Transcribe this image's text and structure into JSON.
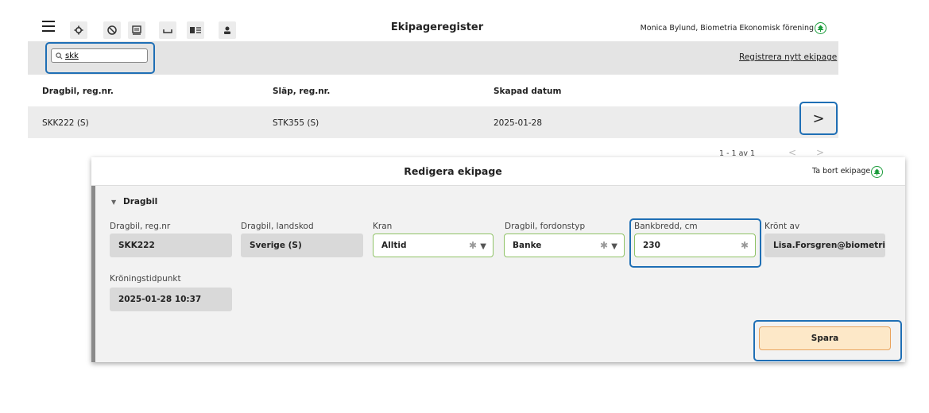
{
  "app": {
    "title": "Ekipageregister",
    "user": "Monica Bylund, Biometria Ekonomisk förening"
  },
  "toolbar": {
    "icons": [
      "menu-icon",
      "gear-icon",
      "no-entry-icon",
      "truck-icon",
      "trailer-icon",
      "vehicle-list-icon",
      "user-icon"
    ]
  },
  "search": {
    "value": "skk"
  },
  "register_link": "Registrera nytt ekipage",
  "table": {
    "headers": [
      "Dragbil, reg.nr.",
      "Släp, reg.nr.",
      "Skapad datum"
    ],
    "rows": [
      [
        "SKK222 (S)",
        "STK355 (S)",
        "2025-01-28"
      ]
    ],
    "row_action": ">"
  },
  "pager": {
    "text": "1 - 1 av 1",
    "prev": "<",
    "next": ">"
  },
  "modal": {
    "title": "Redigera ekipage",
    "delete_label": "Ta bort ekipage",
    "section": {
      "toggle": "▼",
      "title": "Dragbil"
    },
    "fields": {
      "regnr": {
        "label": "Dragbil, reg.nr",
        "value": "SKK222"
      },
      "landskod": {
        "label": "Dragbil, landskod",
        "value": "Sverige (S)"
      },
      "kran": {
        "label": "Kran",
        "value": "Alltid"
      },
      "fordonstyp": {
        "label": "Dragbil, fordonstyp",
        "value": "Banke"
      },
      "bankbredd": {
        "label": "Bankbredd, cm",
        "value": "230"
      },
      "kront": {
        "label": "Krönt av",
        "value": "Lisa.Forsgren@biometria.se"
      },
      "kroningstid": {
        "label": "Kröningstidpunkt",
        "value": "2025-01-28 10:37"
      }
    },
    "save_label": "Spara",
    "clear_glyph": "✱",
    "dropdown_glyph": "▼"
  },
  "colors": {
    "highlight": "#1f6fb5",
    "field_border_green": "#8fc266",
    "save_bg": "#fde8c8",
    "save_border": "#e9a35d",
    "logo_green": "#1a9b3a"
  }
}
